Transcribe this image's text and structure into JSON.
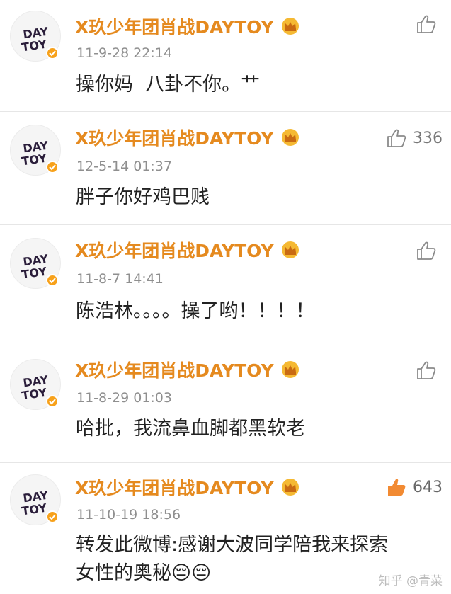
{
  "comments": [
    {
      "username": "X玖少年团肖战DAYTOY",
      "time": "11-9-28 22:14",
      "text": "操你妈  八卦不你。艹",
      "likes": "",
      "liked": false
    },
    {
      "username": "X玖少年团肖战DAYTOY",
      "time": "12-5-14 01:37",
      "text": "胖子你好鸡巴贱",
      "likes": "336",
      "liked": false
    },
    {
      "username": "X玖少年团肖战DAYTOY",
      "time": "11-8-7 14:41",
      "text": "陈浩林。。。。操了哟！！！！",
      "likes": "",
      "liked": false
    },
    {
      "username": "X玖少年团肖战DAYTOY",
      "time": "11-8-29 01:03",
      "text": "哈批，我流鼻血脚都黑软老",
      "likes": "",
      "liked": false
    },
    {
      "username": "X玖少年团肖战DAYTOY",
      "time": "11-10-19 18:56",
      "text": "转发此微博:感谢大波同学陪我来探索\n女性的奥秘😔😔",
      "likes": "643",
      "liked": true
    }
  ],
  "avatar_text": "DAYTOY",
  "watermark": "知乎 @青菜",
  "colors": {
    "username": "#e58a1f",
    "time": "#8f8f8f",
    "liked": "#f28a32",
    "like_outline": "#8a8a8a"
  }
}
